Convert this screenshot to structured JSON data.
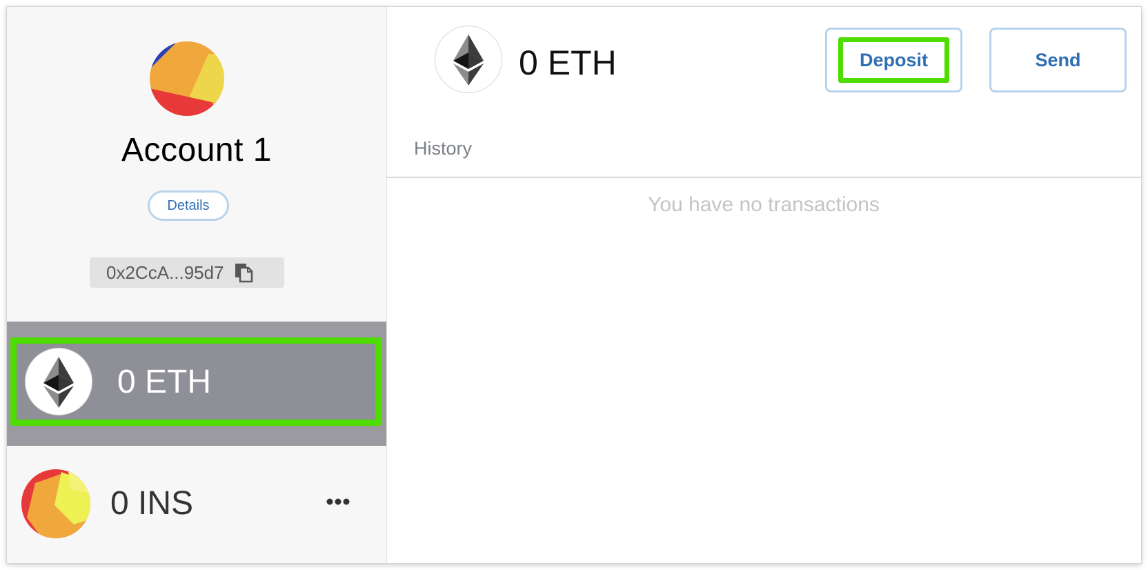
{
  "account": {
    "name": "Account 1",
    "details_label": "Details",
    "address": "0x2CcA...95d7",
    "avatar_icon": "jazzicon-avatar",
    "copy_icon": "copy-icon"
  },
  "tokens": [
    {
      "amount": "0 ETH",
      "icon": "ethereum-icon",
      "selected": true
    },
    {
      "amount": "0 INS",
      "icon": "jazzicon-token-icon",
      "selected": false,
      "menu_label": "•••"
    }
  ],
  "main": {
    "balance": "0 ETH",
    "coin_icon": "ethereum-icon",
    "deposit_label": "Deposit",
    "send_label": "Send",
    "history_tab_label": "History",
    "empty_message": "You have no transactions"
  },
  "colors": {
    "accent_blue": "#2f6fb5",
    "button_border": "#b7d4ec",
    "highlight_green": "#4ddd00",
    "selected_row": "#9a9aa0"
  }
}
